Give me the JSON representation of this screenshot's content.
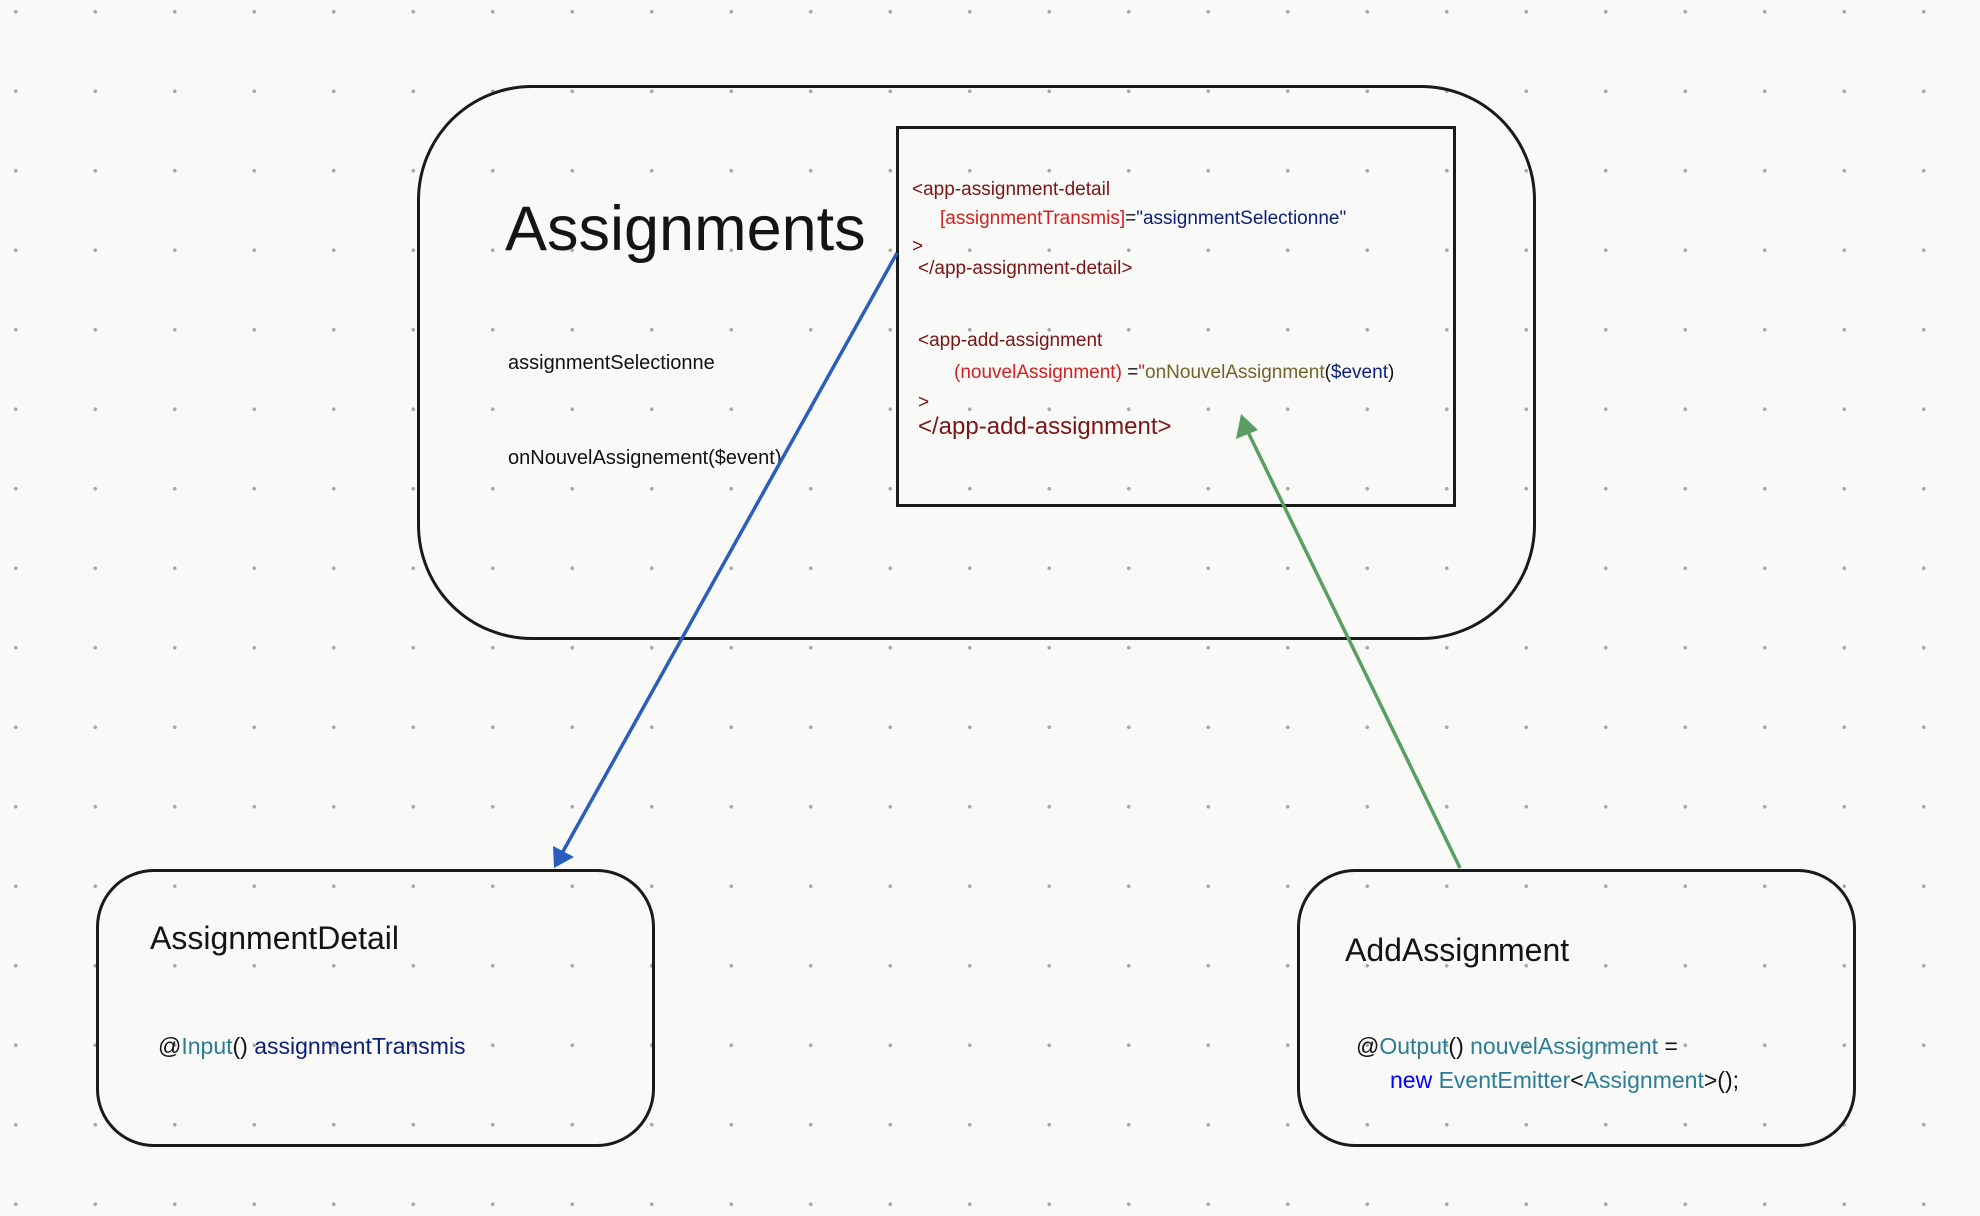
{
  "main_component": {
    "title": "Assignments",
    "property_selected": "assignmentSelectionne",
    "handler_call": "onNouvelAssignement($event)"
  },
  "template_code": {
    "line1_tag": "<app-assignment-detail",
    "line2_attr": "[assignmentTransmis]",
    "line2_eq": "=",
    "line2_value": "\"assignmentSelectionne\"",
    "line3": ">",
    "line4": "</app-assignment-detail>",
    "line5_tag": "<app-add-assignment",
    "line6_attr": "(nouvelAssignment)",
    "line6_eq": " =",
    "line6_quote": "\"",
    "line6_fn": "onNouvelAssignment",
    "line6_open": "(",
    "line6_arg": "$event",
    "line6_close": ")",
    "line7": ">",
    "line8": "</app-add-assignment>"
  },
  "detail_component": {
    "title": "AssignmentDetail",
    "at": "@",
    "decorator": "Input",
    "parens": "() ",
    "member": "assignmentTransmis"
  },
  "add_component": {
    "title": "AddAssignment",
    "at": "@",
    "decorator": "Output",
    "parens": "() ",
    "member": "nouvelAssignment",
    "assign": " =",
    "new_kw": "new",
    "emitter": "EventEmitter",
    "lt": "<",
    "type_arg": "Assignment",
    "end": ">();"
  },
  "colors": {
    "input_arrow": "#2a5ebd",
    "output_arrow": "#5a9e62",
    "border": "#1a1a1a"
  }
}
